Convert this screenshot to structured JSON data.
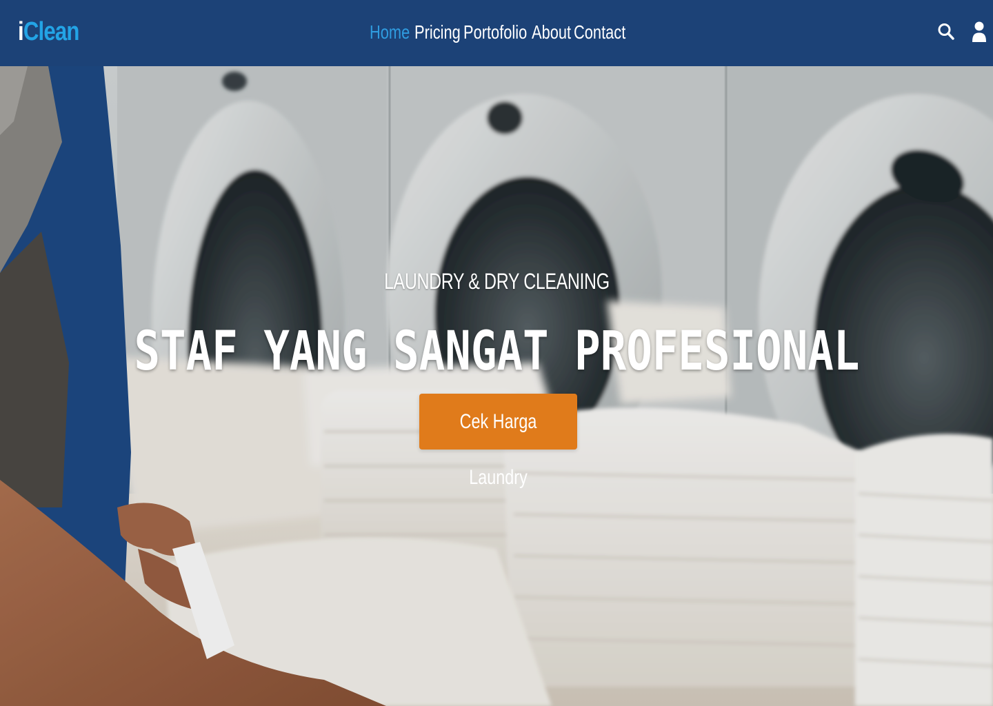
{
  "brand": {
    "logo_first": "i",
    "logo_rest": "Clean"
  },
  "nav": {
    "items": [
      {
        "label": "Home",
        "active": true
      },
      {
        "label": "Pricing",
        "active": false
      },
      {
        "label": "Portofolio",
        "active": false
      },
      {
        "label": "About",
        "active": false
      },
      {
        "label": "Contact",
        "active": false
      }
    ],
    "icons": [
      "search-icon",
      "user-icon"
    ]
  },
  "hero": {
    "subtitle": "LAUNDRY & DRY CLEANING",
    "title": "STAF YANG SANGAT PROFESIONAL",
    "cta_label": "Cek Harga Laundry",
    "background": "laundry-room-photo"
  },
  "colors": {
    "navbar": "#1c4277",
    "logo_accent": "#23a4e6",
    "nav_active": "#2f9ce0",
    "cta": "#e07b1b"
  }
}
